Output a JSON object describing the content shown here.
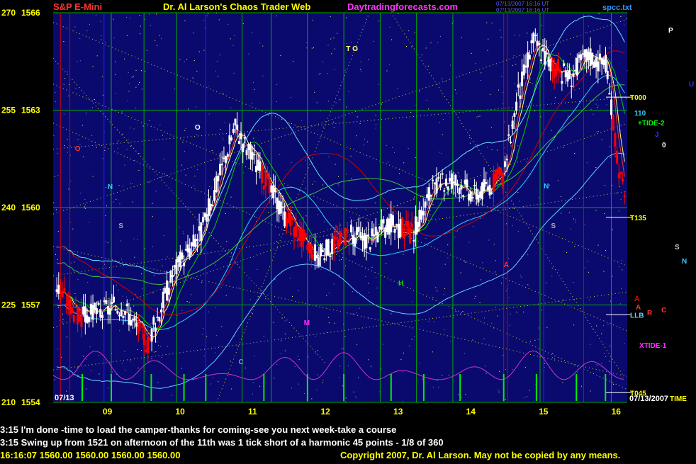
{
  "chart_data": {
    "type": "candlestick",
    "header": {
      "instrument": "S&P E-Mini",
      "title": "Dr. Al Larson's Chaos Trader Web",
      "site": "Daytradingforecasts.com",
      "file": "spcc.txt",
      "stamp1": "07/13/2007 16:16 UT",
      "stamp2": "07/13/2007 16:16 UT"
    },
    "price_axis": [
      {
        "deg": "270",
        "price": "1566"
      },
      {
        "deg": "255",
        "price": "1563"
      },
      {
        "deg": "240",
        "price": "1560"
      },
      {
        "deg": "225",
        "price": "1557"
      },
      {
        "deg": "210",
        "price": "1554"
      }
    ],
    "ylim": [
      1554,
      1566
    ],
    "xlim": [
      8.25,
      16.15
    ],
    "time_axis": [
      "09",
      "10",
      "11",
      "12",
      "13",
      "14",
      "15",
      "16"
    ],
    "date_left": "07/13",
    "date_right": "07/13/2007",
    "time_label": "TIME",
    "ohlc_anchor_points": [
      [
        8.3,
        1557.6
      ],
      [
        8.6,
        1556.6
      ],
      [
        8.9,
        1556.8
      ],
      [
        9.2,
        1557.0
      ],
      [
        9.55,
        1555.8
      ],
      [
        9.9,
        1558.0
      ],
      [
        10.3,
        1559.3
      ],
      [
        10.75,
        1562.5
      ],
      [
        11.05,
        1561.3
      ],
      [
        11.45,
        1559.7
      ],
      [
        11.9,
        1558.5
      ],
      [
        12.3,
        1559.2
      ],
      [
        12.6,
        1559.0
      ],
      [
        12.9,
        1559.5
      ],
      [
        13.2,
        1559.2
      ],
      [
        13.45,
        1560.5
      ],
      [
        13.75,
        1560.9
      ],
      [
        14.05,
        1560.4
      ],
      [
        14.45,
        1561.0
      ],
      [
        14.6,
        1563.0
      ],
      [
        14.85,
        1565.2
      ],
      [
        15.1,
        1564.4
      ],
      [
        15.35,
        1564.0
      ],
      [
        15.6,
        1564.7
      ],
      [
        15.85,
        1564.4
      ],
      [
        16.05,
        1561.0
      ],
      [
        16.15,
        1559.8
      ]
    ],
    "last_price": 1560,
    "red_cluster_times": [
      [
        8.35,
        8.65
      ],
      [
        9.4,
        9.6
      ],
      [
        11.1,
        11.25
      ],
      [
        11.45,
        11.85
      ],
      [
        12.1,
        12.35
      ],
      [
        13.05,
        13.2
      ],
      [
        14.3,
        14.45
      ],
      [
        15.1,
        15.25
      ],
      [
        15.95,
        16.15
      ]
    ],
    "harmonic_lines": [
      {
        "name": "T000",
        "value": 1563.4
      },
      {
        "name": "T135",
        "value": 1559.7
      },
      {
        "name": "LLB",
        "value": 1556.7
      },
      {
        "name": "T045",
        "value": 1554.3
      }
    ],
    "overlay_labels": [
      "T O",
      "O",
      "O",
      "N",
      "S",
      "M",
      "H",
      "C",
      "N",
      "S",
      "P",
      "U",
      "110",
      "+TIDE-2",
      "J",
      "0",
      "S",
      "N",
      "A",
      "A",
      "R",
      "C",
      "XTIDE-1",
      "A"
    ],
    "messages": [
      "3:15 I'm done -time to load the camper-thanks for coming-see you next week-take a course",
      "3:15 Swing up from 1521 on afternoon of the 11th was 1 tick short of a harmonic 45 points - 1/8 of 360"
    ],
    "footer_quote": "16:16:07  1560.00  1560.00  1560.00  1560.00",
    "copyright": "Copyright 2007, Dr. Al Larson. May not be copied by any means.",
    "colors": {
      "background": "#0a0a6e",
      "frame": "#000000",
      "axis_text": "#ffff00",
      "title": "#ffff00",
      "instrument": "#ff3333",
      "site": "#ff33ff",
      "up_bar": "#ffffff",
      "down_bar": "#ff0000",
      "ma_red": "#cc0000",
      "ma_green": "#00cc00",
      "ma_cyan": "#33ccff",
      "osc_magenta": "#cc33cc",
      "spike_green": "#00ee00",
      "gridline": "#00aa00"
    }
  }
}
